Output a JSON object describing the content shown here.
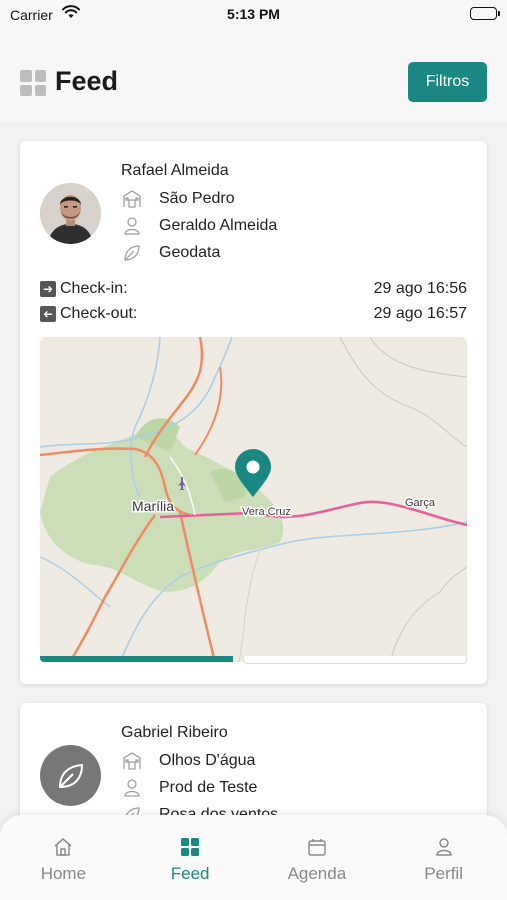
{
  "status_bar": {
    "carrier": "Carrier",
    "time": "5:13 PM"
  },
  "header": {
    "title": "Feed",
    "filter_label": "Filtros"
  },
  "feed": [
    {
      "name": "Rafael Almeida",
      "location": "São Pedro",
      "contact": "Geraldo Almeida",
      "company": "Geodata",
      "checkin_label": "Check-in:",
      "checkin_value": "29 ago 16:56",
      "checkout_label": "Check-out:",
      "checkout_value": "29 ago 16:57",
      "map": {
        "city_main": "Marília",
        "city_pin": "Vera Cruz",
        "city_right": "Garça"
      },
      "progress": 0.5
    },
    {
      "name": "Gabriel Ribeiro",
      "location": "Olhos D'água",
      "contact": "Prod de Teste",
      "company": "Rosa dos ventos"
    }
  ],
  "tabs": [
    {
      "label": "Home",
      "icon": "home-icon"
    },
    {
      "label": "Feed",
      "icon": "grid-icon"
    },
    {
      "label": "Agenda",
      "icon": "calendar-icon"
    },
    {
      "label": "Perfil",
      "icon": "person-icon"
    }
  ],
  "colors": {
    "accent": "#1b8783",
    "inactive": "#888888"
  }
}
